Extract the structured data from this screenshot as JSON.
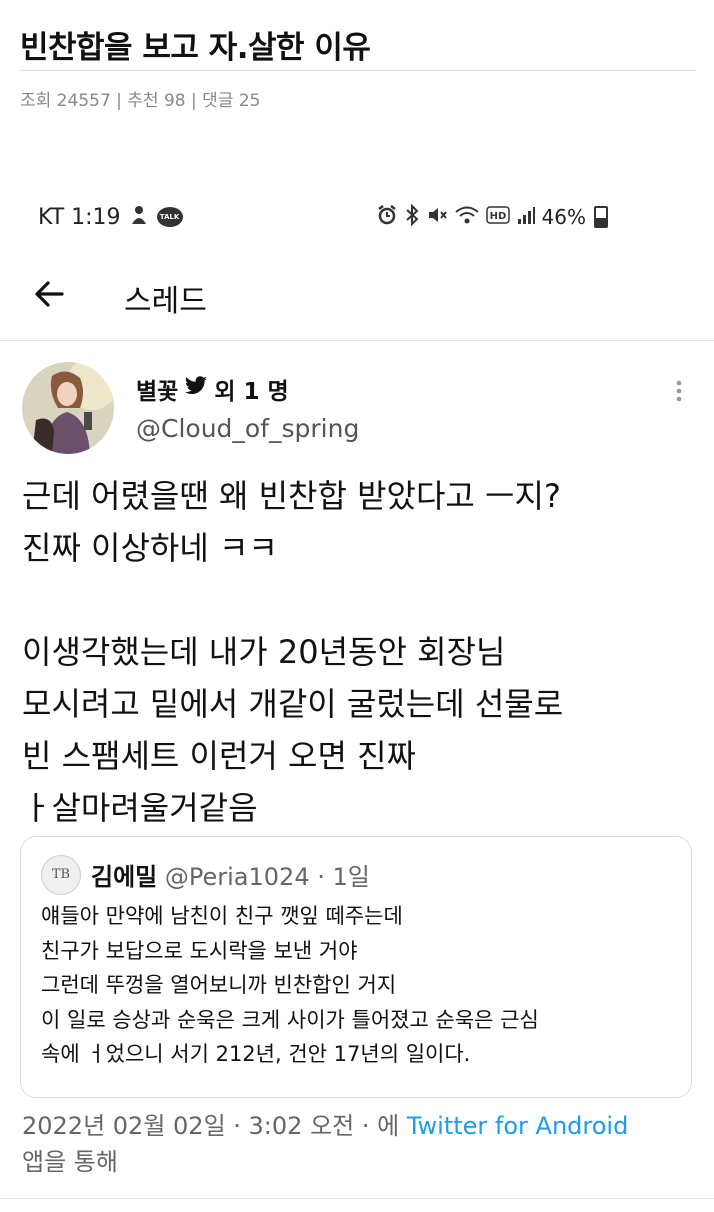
{
  "post": {
    "title": "빈찬합을 보고 자.살한 이유",
    "meta": "조회 24557 | 추천 98 | 댓글 25"
  },
  "status_bar": {
    "carrier_time": "KT 1:19",
    "talk_label": "TALK",
    "battery": "46%",
    "battery_level": 0.46
  },
  "topbar": {
    "back_icon": "back-arrow-icon",
    "title": "스레드"
  },
  "tweet": {
    "author_name": "별꽃",
    "author_suffix": "외 1 명",
    "handle": "@Cloud_of_spring",
    "body": "근데 어렸을땐 왜 빈찬합 받았다고 ㅡ지?\n진짜 이상하네 ㅋㅋ\n\n이생각했는데 내가 20년동안 회장님\n모시려고 밑에서 개같이 굴렀는데 선물로\n빈 스팸세트 이런거 오면 진짜\nㅏ살마려울거같음",
    "date_time": "2022년 02월 02일 · 3:02 오전 · 에",
    "source": "Twitter for Android",
    "source_suffix": "앱을 통해"
  },
  "quote": {
    "avatar_text": "TB",
    "name": "김에밀",
    "handle_time": "@Peria1024 · 1일",
    "body": "얘들아 만약에 남친이 친구 깻잎 떼주는데\n친구가 보답으로 도시락을 보낸 거야\n그런데 뚜껑을 열어보니까 빈찬합인 거지\n이 일로 승상과 순욱은 크게 사이가 틀어졌고 순욱은 근심\n속에 ㅓ었으니 서기 212년, 건안 17년의 일이다."
  },
  "colors": {
    "accent": "#1d9bf0",
    "text": "#111111",
    "muted": "#666666"
  }
}
